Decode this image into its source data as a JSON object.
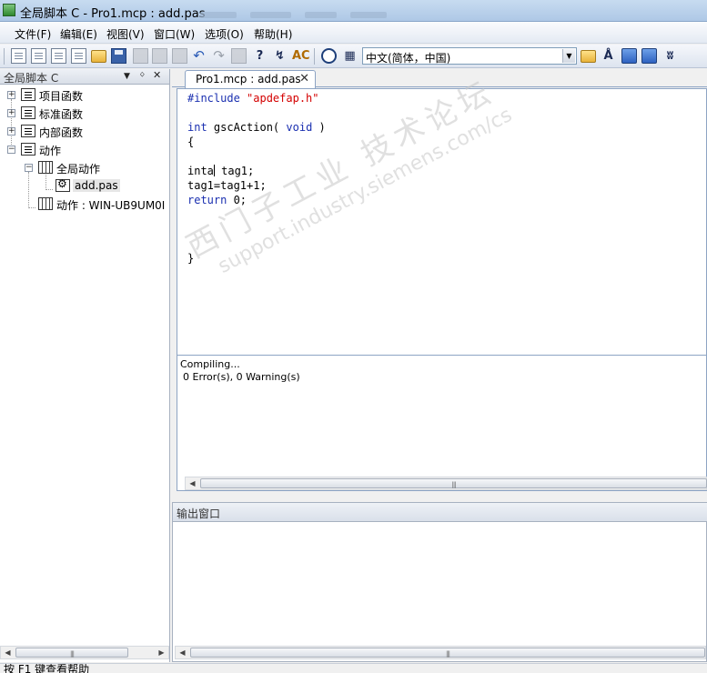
{
  "window": {
    "title": "全局脚本 C - Pro1.mcp : add.pas"
  },
  "menu": {
    "items": [
      "文件(F)",
      "编辑(E)",
      "视图(V)",
      "窗口(W)",
      "选项(O)",
      "帮助(H)"
    ]
  },
  "toolbar": {
    "language_value": "中文(简体，中国)"
  },
  "left_panel": {
    "title": "全局脚本 C",
    "controls": {
      "dropdown": "▼",
      "pin": "ᛜ",
      "close": "✕"
    },
    "tree": [
      {
        "label": "项目函数",
        "icon": "function-list-icon",
        "expander": "+"
      },
      {
        "label": "标准函数",
        "icon": "function-list-icon",
        "expander": "+"
      },
      {
        "label": "内部函数",
        "icon": "function-list-icon",
        "expander": "+"
      },
      {
        "label": "动作",
        "icon": "function-list-icon",
        "expander": "−"
      },
      {
        "label": "全局动作",
        "icon": "action-folder-icon",
        "expander": "−"
      },
      {
        "label": "add.pas",
        "icon": "script-file-icon"
      },
      {
        "label": "动作 : WIN-UB9UM0I",
        "icon": "action-folder-icon"
      }
    ]
  },
  "editor": {
    "tab_label": "Pro1.mcp : add.pas",
    "tab_close": "✕",
    "code": {
      "include_kw": "#include",
      "include_str": "\"apdefap.h\"",
      "fn_kw_int": "int",
      "fn_name": " gscAction( ",
      "fn_kw_void": "void",
      "fn_close": " )",
      "open_brace": "{",
      "decl_a": "inta",
      "decl_b": " tag1;",
      "assign": "tag1=tag1+1;",
      "ret_kw": "return",
      "ret_val": " 0;",
      "close_brace": "}"
    }
  },
  "compile_output": {
    "line1": "Compiling...",
    "line2": "0 Error(s), 0 Warning(s)"
  },
  "output_window": {
    "title": "输出窗口"
  },
  "status_bar": {
    "text": "按 F1 键查看帮助"
  },
  "watermark": {
    "line1": "西门子工业 技术论坛",
    "line2": "support.industry.siemens.com/cs"
  },
  "colors": {
    "keyword": "#1a2fb0",
    "string": "#d40000"
  }
}
